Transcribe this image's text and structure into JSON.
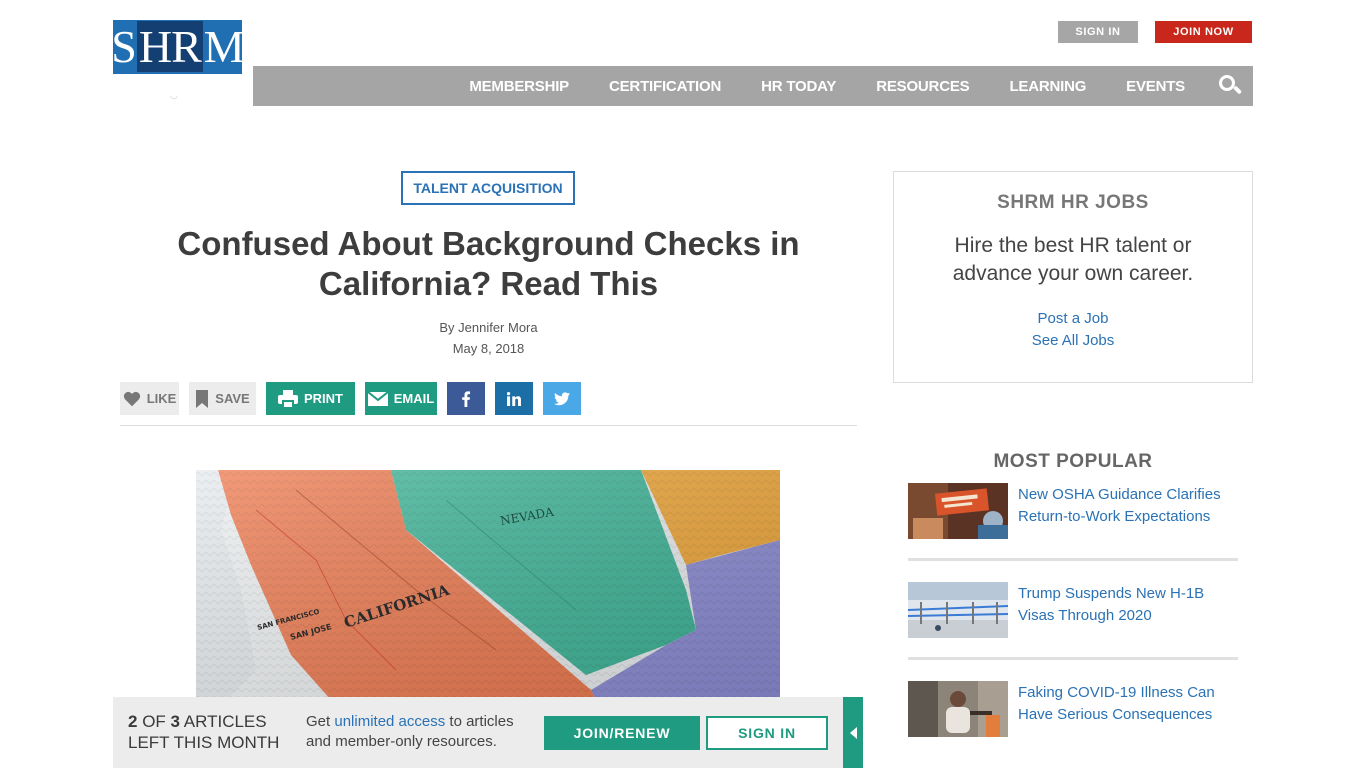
{
  "header": {
    "logo_text_left": "S",
    "logo_text_mid": "HR",
    "logo_text_right": "M",
    "sign_in_label": "SIGN IN",
    "join_now_label": "JOIN NOW",
    "nav": [
      "MEMBERSHIP",
      "CERTIFICATION",
      "HR TODAY",
      "RESOURCES",
      "LEARNING",
      "EVENTS"
    ],
    "search_icon": "search-icon"
  },
  "article": {
    "category": "TALENT ACQUISITION",
    "title": "Confused About Background Checks in California? Read This",
    "byline": "By Jennifer Mora",
    "date": "May 8, 2018",
    "share": {
      "like": "LIKE",
      "save": "SAVE",
      "print": "PRINT",
      "email": "EMAIL",
      "facebook_icon": "facebook-icon",
      "linkedin_icon": "linkedin-icon",
      "twitter_icon": "twitter-icon"
    },
    "hero_map_labels": {
      "state1": "CALIFORNIA",
      "state2": "NEVADA",
      "city1": "SAN FRANCISCO",
      "city2": "SAN JOSE"
    }
  },
  "sidebar": {
    "jobs": {
      "title": "SHRM HR JOBS",
      "description": "Hire the best HR talent or advance your own career.",
      "link1": "Post a Job",
      "link2": "See All Jobs"
    },
    "popular_title": "MOST POPULAR",
    "popular": [
      "New OSHA Guidance Clarifies Return-to-Work Expectations",
      "Trump Suspends New H-1B Visas Through 2020",
      "Faking COVID-19 Illness Can Have Serious Consequences"
    ]
  },
  "paywall": {
    "count_current": "2",
    "count_of": " OF ",
    "count_total": "3",
    "count_suffix": " ARTICLES",
    "count_line2": "LEFT THIS MONTH",
    "msg_prefix": "Get ",
    "msg_link": "unlimited access",
    "msg_suffix": " to articles and member-only resources.",
    "join_label": "JOIN/RENEW",
    "signin_label": "SIGN IN"
  },
  "colors": {
    "brand_blue": "#1f6fb2",
    "teal": "#1e9b80",
    "red": "#c9271b",
    "nav_gray": "#a5a5a5"
  }
}
